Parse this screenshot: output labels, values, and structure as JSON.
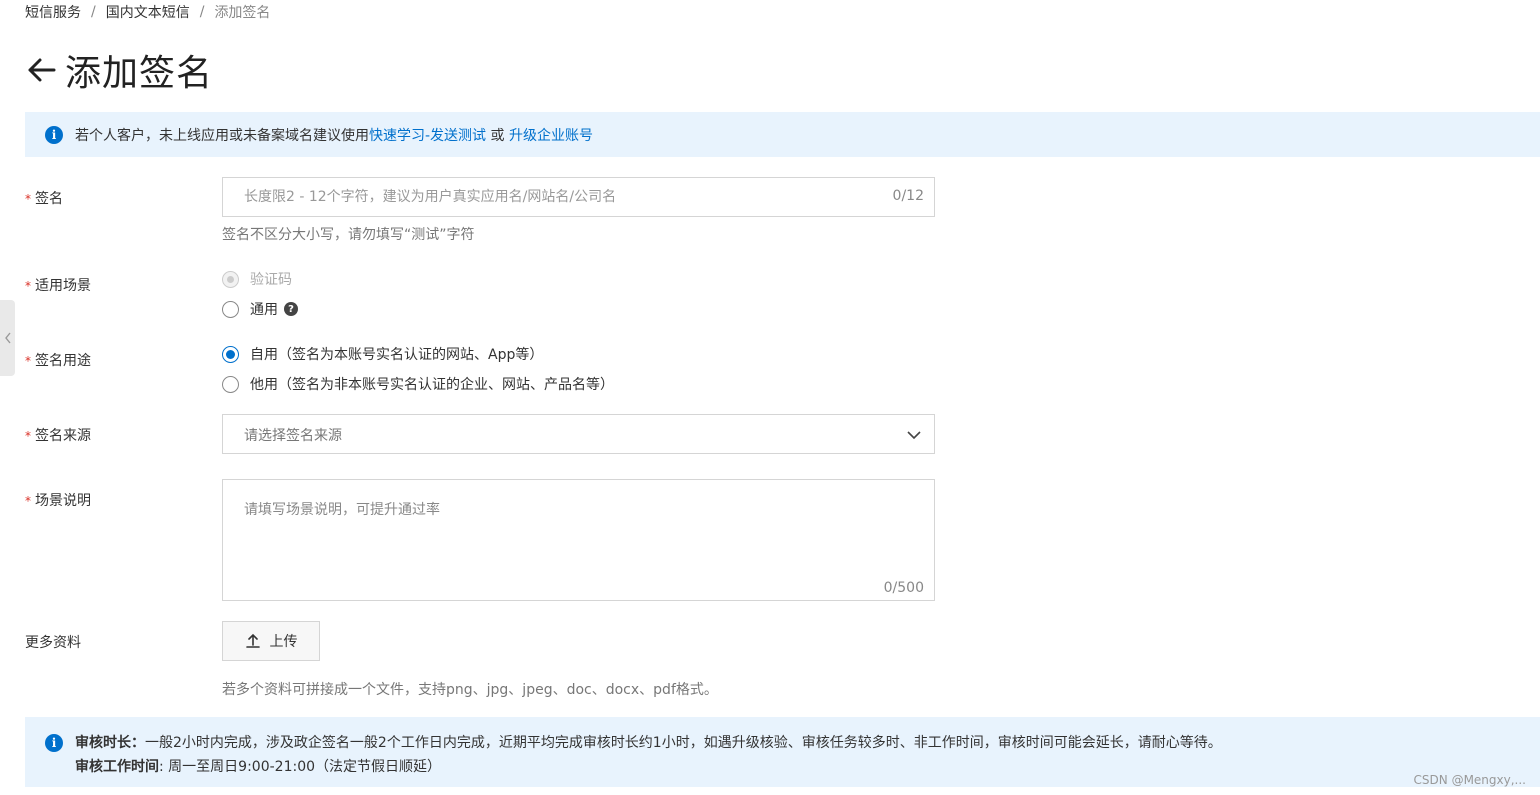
{
  "breadcrumb": {
    "items": [
      "短信服务",
      "国内文本短信",
      "添加签名"
    ],
    "separator": "/"
  },
  "header": {
    "title": "添加签名"
  },
  "top_notice": {
    "text": "若个人客户，未上线应用或未备案域名建议使用",
    "link1": "快速学习-发送测试",
    "or": "或",
    "link2": "升级企业账号"
  },
  "form": {
    "required_mark": "*",
    "signature": {
      "label": "签名",
      "placeholder": "长度限2 - 12个字符，建议为用户真实应用名/网站名/公司名",
      "counter": "0/12",
      "hint": "签名不区分大小写，请勿填写“测试”字符"
    },
    "scenario": {
      "label": "适用场景",
      "options": [
        "验证码",
        "通用"
      ]
    },
    "usage": {
      "label": "签名用途",
      "options": [
        "自用（签名为本账号实名认证的网站、App等）",
        "他用（签名为非本账号实名认证的企业、网站、产品名等）"
      ],
      "selected": "自用（签名为本账号实名认证的网站、App等）"
    },
    "source": {
      "label": "签名来源",
      "placeholder": "请选择签名来源"
    },
    "description": {
      "label": "场景说明",
      "placeholder": "请填写场景说明，可提升通过率",
      "counter": "0/500"
    },
    "more": {
      "label": "更多资料",
      "upload_label": "上传",
      "hint": "若多个资料可拼接成一个文件，支持png、jpg、jpeg、doc、docx、pdf格式。"
    }
  },
  "bottom_notice": {
    "line1_bold": "审核时长：",
    "line1_text": "一般2小时内完成，涉及政企签名一般2个工作日内完成，近期平均完成审核时长约1小时，如遇升级核验、审核任务较多时、非工作时间，审核时间可能会延长，请耐心等待。",
    "line2_bold": "审核工作时间",
    "line2_text": ": 周一至周日9:00-21:00（法定节假日顺延）"
  },
  "watermark": "CSDN @Mengxy,..."
}
